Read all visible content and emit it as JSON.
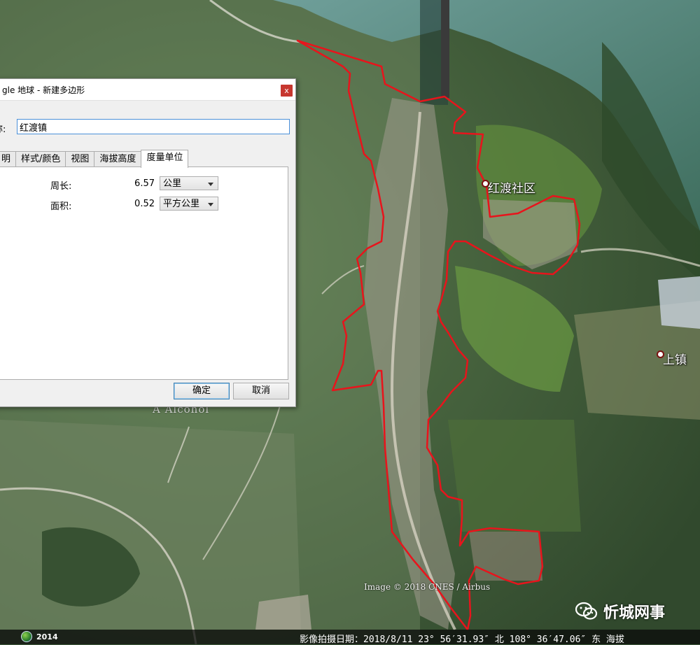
{
  "dialog": {
    "title": "gle 地球 - 新建多边形",
    "close_glyph": "x",
    "name_label": "称:",
    "name_value": "红渡镇",
    "tabs": [
      {
        "label": "明"
      },
      {
        "label": "样式/颜色"
      },
      {
        "label": "视图"
      },
      {
        "label": "海拔高度"
      },
      {
        "label": "度量单位",
        "active": true
      }
    ],
    "measurements": {
      "perimeter": {
        "label": "周长:",
        "value": "6.57",
        "unit": "公里"
      },
      "area": {
        "label": "面积:",
        "value": "0.52",
        "unit": "平方公里"
      }
    },
    "ok_label": "确定",
    "cancel_label": "取消"
  },
  "map": {
    "labels": {
      "community": "红渡社区",
      "town": "上镇",
      "faint": "A Alcohol"
    },
    "credit": "Image © 2018 CNES / Airbus",
    "polygon_color": "#e8141c"
  },
  "statusbar": {
    "year": "2014",
    "info": "影像拍摄日期：2018/8/11   23° 56′31.93″ 北 108° 36′47.06″ 东 海拔"
  },
  "watermark": {
    "text": "忻城网事"
  }
}
